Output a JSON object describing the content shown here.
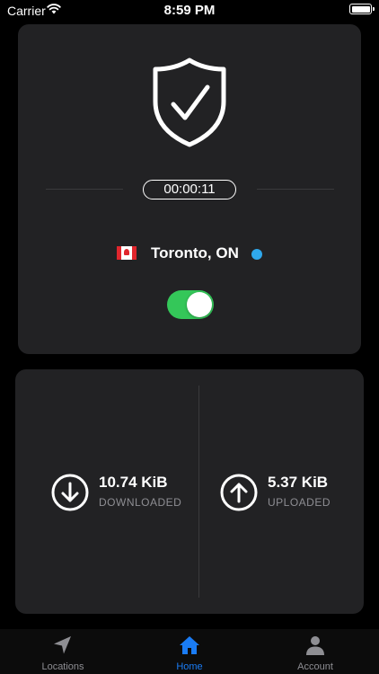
{
  "status_bar": {
    "carrier": "Carrier",
    "time": "8:59 PM"
  },
  "connection": {
    "timer": "00:00:11",
    "location": "Toronto, ON",
    "flag": "canada-flag",
    "connected": true,
    "status_dot_color": "#2fa8ec",
    "toggle_color": "#34c759"
  },
  "stats": {
    "downloaded": {
      "value": "10.74 KiB",
      "label": "DOWNLOADED",
      "icon": "arrow-down-circle-icon"
    },
    "uploaded": {
      "value": "5.37 KiB",
      "label": "UPLOADED",
      "icon": "arrow-up-circle-icon"
    }
  },
  "tabs": [
    {
      "label": "Locations",
      "icon": "location-arrow-icon",
      "active": false
    },
    {
      "label": "Home",
      "icon": "house-icon",
      "active": true
    },
    {
      "label": "Account",
      "icon": "person-icon",
      "active": false
    }
  ],
  "colors": {
    "accent": "#1a7cf5",
    "card": "#222224",
    "background": "#000000"
  }
}
